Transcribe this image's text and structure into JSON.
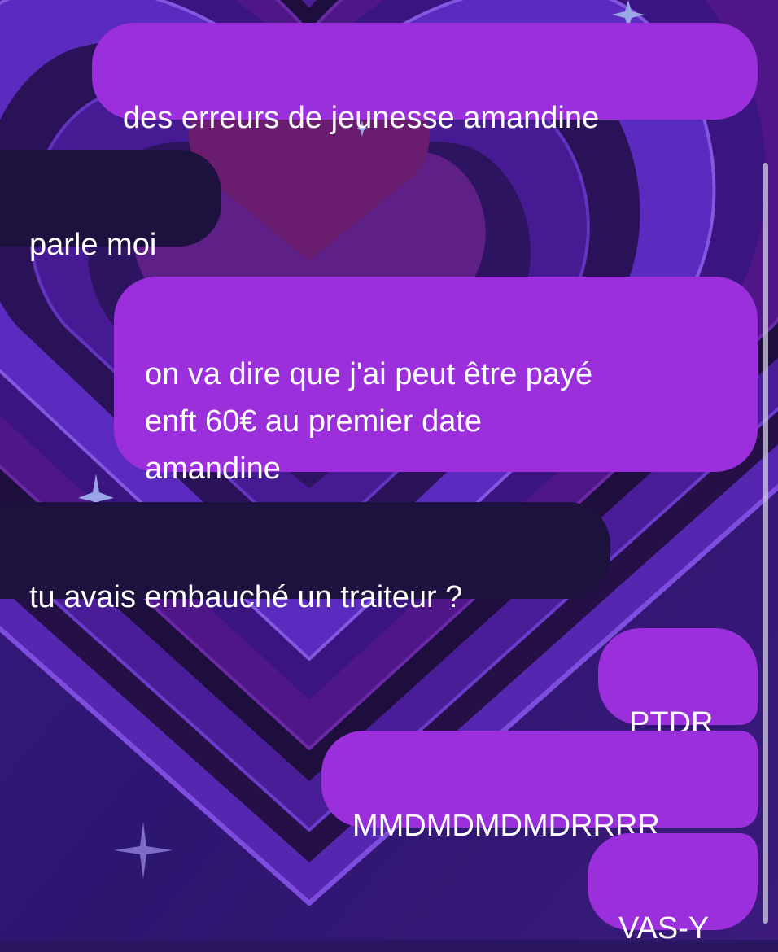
{
  "chat": {
    "messages": [
      {
        "direction": "sent",
        "text": "des erreurs de jeunesse amandine"
      },
      {
        "direction": "received",
        "text": "parle moi"
      },
      {
        "direction": "sent",
        "text": "on va dire que j'ai peut être payé\nenft 60€ au premier date\namandine"
      },
      {
        "direction": "received",
        "text": "tu avais embauché un traiteur ?"
      },
      {
        "direction": "sent",
        "text": "PTDR"
      },
      {
        "direction": "sent",
        "text": "MMDMDMDMDRRRR"
      },
      {
        "direction": "sent",
        "text": "VAS-Y"
      }
    ]
  },
  "theme": {
    "sent_bubble_color": "#9a2fdb",
    "received_bubble_color": "#1d123d",
    "background_color": "#2a1660",
    "text_color": "#ffffff",
    "background_decoration": "nested-hearts",
    "sparkle_icon": "four-point-star"
  }
}
